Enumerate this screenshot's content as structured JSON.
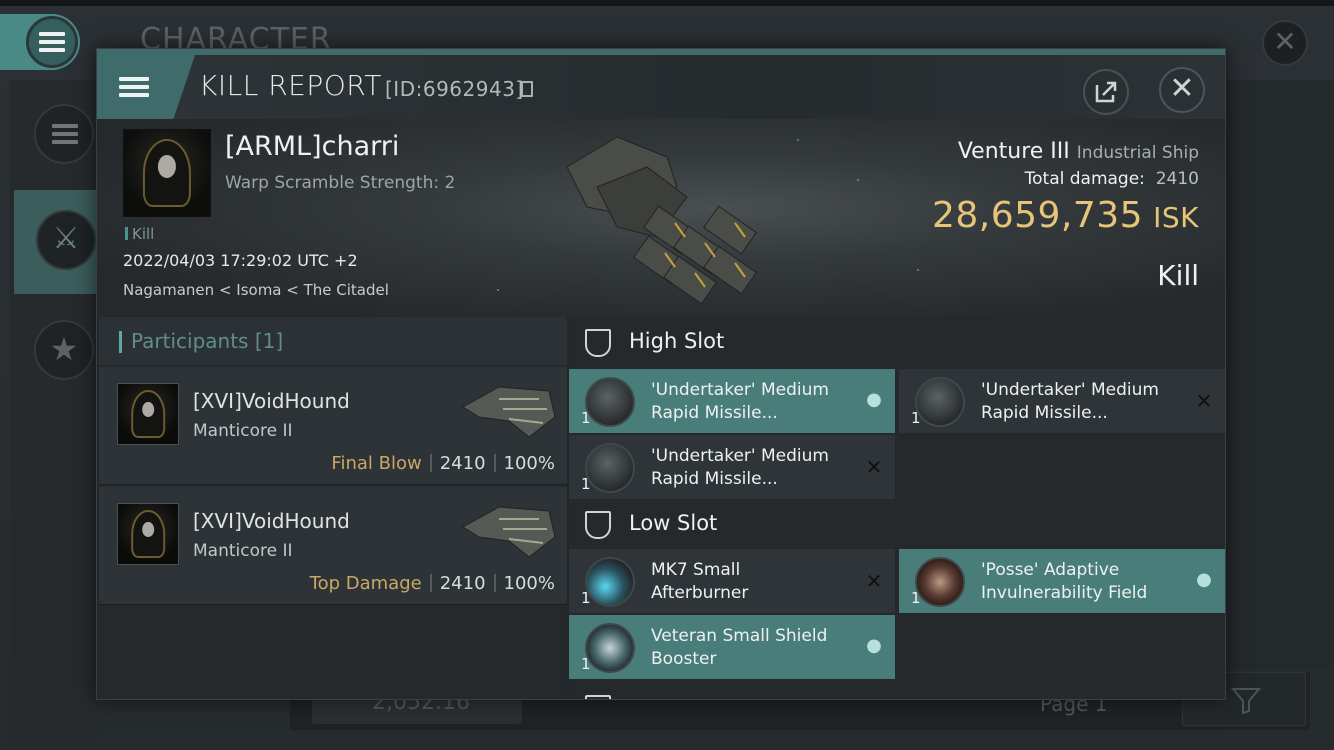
{
  "background": {
    "title": "CHARACTER",
    "balance": "2,052.16",
    "page": "Page 1"
  },
  "header": {
    "title": "KILL REPORT",
    "id_label": "[ID:6962943]"
  },
  "victim": {
    "pilot": "[ARML]charri",
    "warp_scramble": "Warp Scramble Strength: 2",
    "tag": "Kill",
    "datetime": "2022/04/03 17:29:02 UTC +2",
    "location": "Nagamanen < Isoma < The Citadel",
    "ship_name": "Venture III",
    "ship_class": "Industrial Ship",
    "total_damage_label": "Total damage:",
    "total_damage": "2410",
    "isk_value": "28,659,735",
    "isk_unit": "ISK",
    "result": "Kill"
  },
  "participants": {
    "title": "Participants [1]",
    "rows": [
      {
        "name": "[XVI]VoidHound",
        "ship": "Manticore II",
        "label": "Final Blow",
        "damage": "2410",
        "percent": "100%"
      },
      {
        "name": "[XVI]VoidHound",
        "ship": "Manticore II",
        "label": "Top Damage",
        "damage": "2410",
        "percent": "100%"
      }
    ]
  },
  "fitting": {
    "high_slot": {
      "title": "High Slot",
      "items": [
        {
          "name": "'Undertaker' Medium\nRapid Missile...",
          "count": "1",
          "status": "person-icon",
          "owned": true
        },
        {
          "name": "'Undertaker' Medium\nRapid Missile...",
          "count": "1",
          "status": "destroyed-icon",
          "owned": false
        },
        {
          "name": "'Undertaker' Medium\nRapid Missile...",
          "count": "1",
          "status": "destroyed-icon",
          "owned": false
        }
      ]
    },
    "low_slot": {
      "title": "Low Slot",
      "items": [
        {
          "name": "MK7 Small\nAfterburner",
          "count": "1",
          "status": "destroyed-icon",
          "owned": false
        },
        {
          "name": "'Posse' Adaptive\nInvulnerability Field",
          "count": "1",
          "status": "person-icon",
          "owned": true
        },
        {
          "name": "Veteran Small Shield\nBooster",
          "count": "1",
          "status": "person-icon",
          "owned": true
        }
      ]
    }
  },
  "colors": {
    "accent": "#4a8a86",
    "owned_item": "#497d7a",
    "isk": "#e6c57a",
    "final_blow": "#c9a863"
  }
}
